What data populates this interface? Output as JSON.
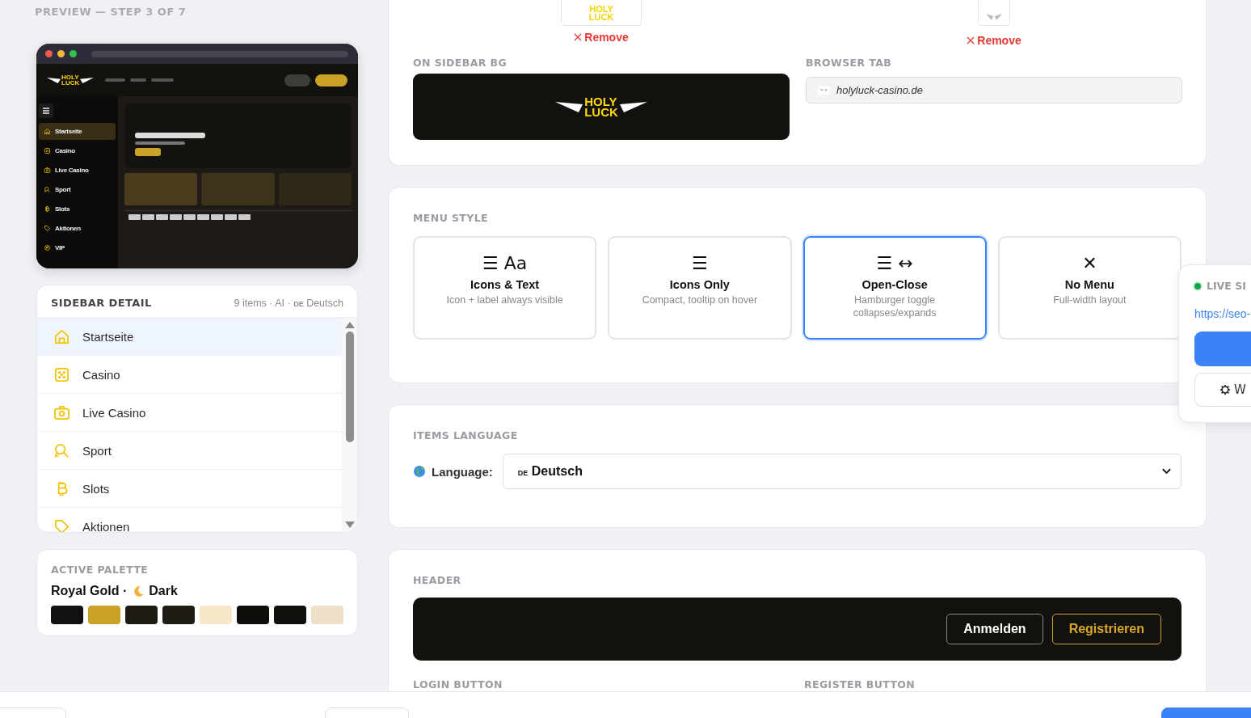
{
  "preview": {
    "caption": "PREVIEW — STEP 3 OF 7",
    "logo": [
      "HOLY",
      "LUCK"
    ],
    "nav": [
      {
        "label": "Startseite",
        "kind": "home",
        "selected": true
      },
      {
        "label": "Casino",
        "kind": "dice",
        "selected": false
      },
      {
        "label": "Live Casino",
        "kind": "camera",
        "selected": false
      },
      {
        "label": "Sport",
        "kind": "sport",
        "selected": false
      },
      {
        "label": "Slots",
        "kind": "bitcoin",
        "selected": false
      },
      {
        "label": "Aktionen",
        "kind": "tag",
        "selected": false
      },
      {
        "label": "VIP",
        "kind": "vip",
        "selected": false
      }
    ]
  },
  "sidebar_detail": {
    "title": "SIDEBAR DETAIL",
    "meta": "9 items · AI ·",
    "lang_code": "DE",
    "lang": "Deutsch",
    "items": [
      {
        "label": "Startseite",
        "kind": "home",
        "selected": true
      },
      {
        "label": "Casino",
        "kind": "dice",
        "selected": false
      },
      {
        "label": "Live Casino",
        "kind": "camera",
        "selected": false
      },
      {
        "label": "Sport",
        "kind": "sport",
        "selected": false
      },
      {
        "label": "Slots",
        "kind": "bitcoin",
        "selected": false
      },
      {
        "label": "Aktionen",
        "kind": "tag",
        "selected": false
      }
    ]
  },
  "palette": {
    "title": "ACTIVE PALETTE",
    "name": "Royal Gold ·",
    "mode": "Dark",
    "swatches": [
      {
        "color": "#141210"
      },
      {
        "color": "#c9a227"
      },
      {
        "color": "#1e1a14"
      },
      {
        "color": "#1f1b15"
      },
      {
        "color": "#f6e7c8"
      },
      {
        "color": "#0f0e0b"
      },
      {
        "color": "#12100c"
      },
      {
        "color": "#ede0c6"
      }
    ]
  },
  "logos": {
    "uploads": [
      {
        "kind": "full",
        "logo": [
          "HOLY",
          "LUCK"
        ],
        "action": "Remove"
      },
      {
        "kind": "mark",
        "action": "Remove"
      }
    ],
    "sidebar_bg": {
      "label": "ON SIDEBAR BG",
      "logo": [
        "HOLY",
        "LUCK"
      ]
    },
    "browser_tab": {
      "label": "BROWSER TAB",
      "url": "holyluck-casino.de"
    }
  },
  "menu_style": {
    "title": "MENU STYLE",
    "options": [
      {
        "glyph": "☰ Aa",
        "label": "Icons & Text",
        "desc": "Icon + label always visible",
        "selected": false
      },
      {
        "glyph": "☰",
        "label": "Icons Only",
        "desc": "Compact, tooltip on hover",
        "selected": false
      },
      {
        "glyph": "☰ ↔",
        "label": "Open-Close",
        "desc": "Hamburger toggle collapses/expands",
        "selected": true
      },
      {
        "glyph": "✕",
        "label": "No Menu",
        "desc": "Full-width layout",
        "selected": false
      }
    ]
  },
  "items_language": {
    "title": "ITEMS LANGUAGE",
    "label": "Language:",
    "code": "DE",
    "value": "Deutsch"
  },
  "header": {
    "title": "HEADER",
    "buttons": [
      {
        "label": "Anmelden",
        "kind": "login"
      },
      {
        "label": "Registrieren",
        "kind": "register"
      }
    ],
    "login_label": "LOGIN BUTTON",
    "register_label": "REGISTER BUTTON"
  },
  "live_site": {
    "title": "LIVE SI",
    "url": "https://seo-",
    "button": "W"
  }
}
